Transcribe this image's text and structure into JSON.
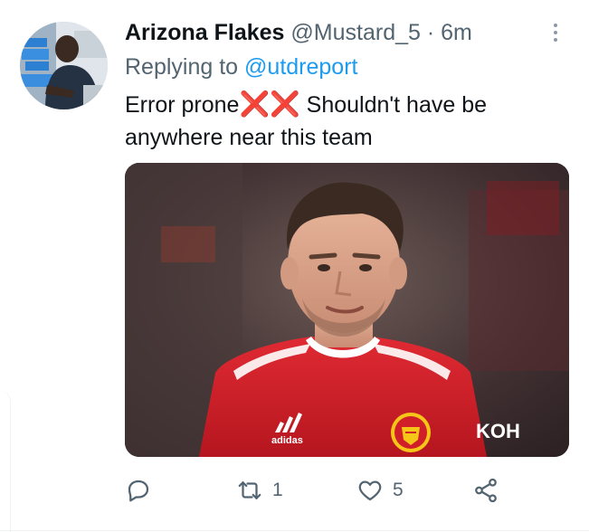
{
  "tweet": {
    "display_name": "Arizona Flakes",
    "handle": "@Mustard_5",
    "separator": "·",
    "time": "6m",
    "replying_prefix": "Replying to",
    "replying_to": "@utdreport",
    "text_before": "Error prone",
    "emoji": "❌❌",
    "text_after": " Shouldn't have be anywhere near this team",
    "media": {
      "shirt_sponsor": "KOH",
      "kit_brand": "adidas"
    }
  },
  "actions": {
    "reply_icon": "reply-icon",
    "retweet_icon": "retweet-icon",
    "retweet_count": "1",
    "like_icon": "heart-icon",
    "like_count": "5",
    "share_icon": "share-icon"
  },
  "colors": {
    "accent": "#1d9bf0",
    "muted": "#536471",
    "text": "#0f1419",
    "shirt_red": "#d11f2a"
  }
}
